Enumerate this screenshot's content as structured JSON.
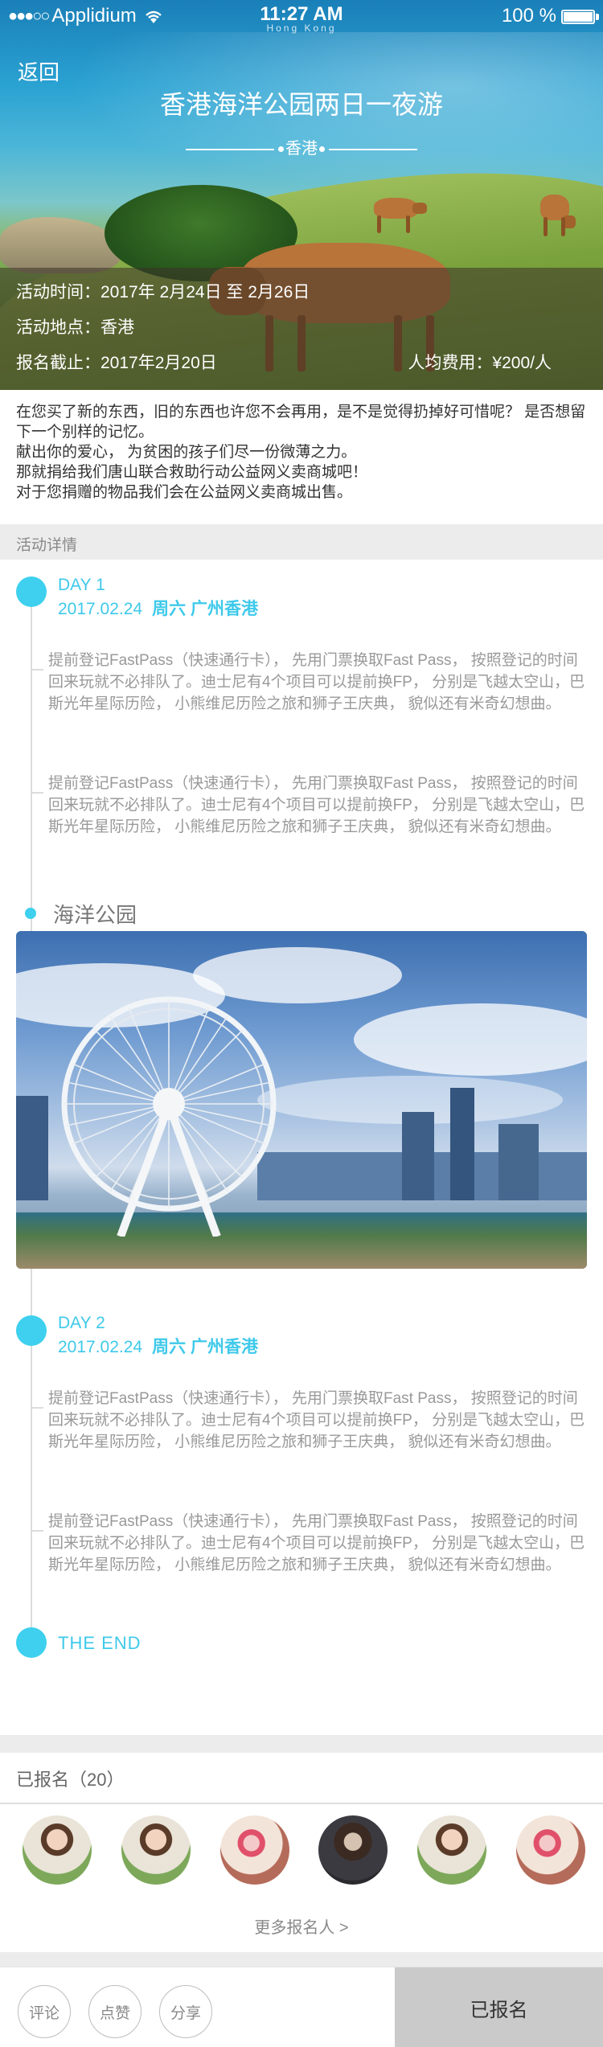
{
  "status_bar": {
    "carrier": "Applidium",
    "time": "11:27 AM",
    "watermark": "Hong Kong",
    "battery": "100 %"
  },
  "header": {
    "back_label": "返回",
    "title": "香港海洋公园两日一夜游",
    "subtitle": "香港"
  },
  "info": {
    "time": "活动时间：2017年  2月24日 至  2月26日",
    "location": "活动地点：香港",
    "deadline": "报名截止：2017年2月20日",
    "fee": "人均费用：¥200/人"
  },
  "intro": [
    "在您买了新的东西，旧的东西也许您不会再用，是不是觉得扔掉好可惜呢？ 是否想留下一个别样的记忆。",
    "献出你的爱心， 为贫困的孩子们尽一份微薄之力。",
    "那就捐给我们唐山联合救助行动公益网义卖商城吧！",
    "对于您捐赠的物品我们会在公益网义卖商城出售。"
  ],
  "section_title": "活动详情",
  "days": [
    {
      "label": "DAY 1",
      "date": "2017.02.24",
      "weekday_place": "周六  广州香港",
      "items": [
        "提前登记FastPass（快速通行卡）， 先用门票换取Fast Pass， 按照登记的时间回来玩就不必排队了。迪士尼有4个项目可以提前换FP， 分别是飞越太空山，巴斯光年星际历险， 小熊维尼历险之旅和狮子王庆典， 貌似还有米奇幻想曲。",
        "提前登记FastPass（快速通行卡）， 先用门票换取Fast Pass， 按照登记的时间回来玩就不必排队了。迪士尼有4个项目可以提前换FP， 分别是飞越太空山，巴斯光年星际历险， 小熊维尼历险之旅和狮子王庆典， 貌似还有米奇幻想曲。"
      ]
    },
    {
      "label": "DAY 2",
      "date": "2017.02.24",
      "weekday_place": "周六  广州香港",
      "items": [
        "提前登记FastPass（快速通行卡）， 先用门票换取Fast Pass， 按照登记的时间回来玩就不必排队了。迪士尼有4个项目可以提前换FP， 分别是飞越太空山，巴斯光年星际历险， 小熊维尼历险之旅和狮子王庆典， 貌似还有米奇幻想曲。",
        "提前登记FastPass（快速通行卡）， 先用门票换取Fast Pass， 按照登记的时间回来玩就不必排队了。迪士尼有4个项目可以提前换FP， 分别是飞越太空山，巴斯光年星际历险， 小熊维尼历险之旅和狮子王庆典， 貌似还有米奇幻想曲。"
      ]
    }
  ],
  "place_label": "海洋公园",
  "end_label": "THE  END",
  "registered": {
    "title": "已报名（20）",
    "more": "更多报名人 >"
  },
  "bottom": {
    "comment": "评论",
    "like": "点赞",
    "share": "分享",
    "signed": "已报名"
  },
  "colors": {
    "accent": "#3ED0EE",
    "muted_text": "#999999",
    "section_bg": "#ECECEC",
    "signed_bg": "#CACACA"
  }
}
